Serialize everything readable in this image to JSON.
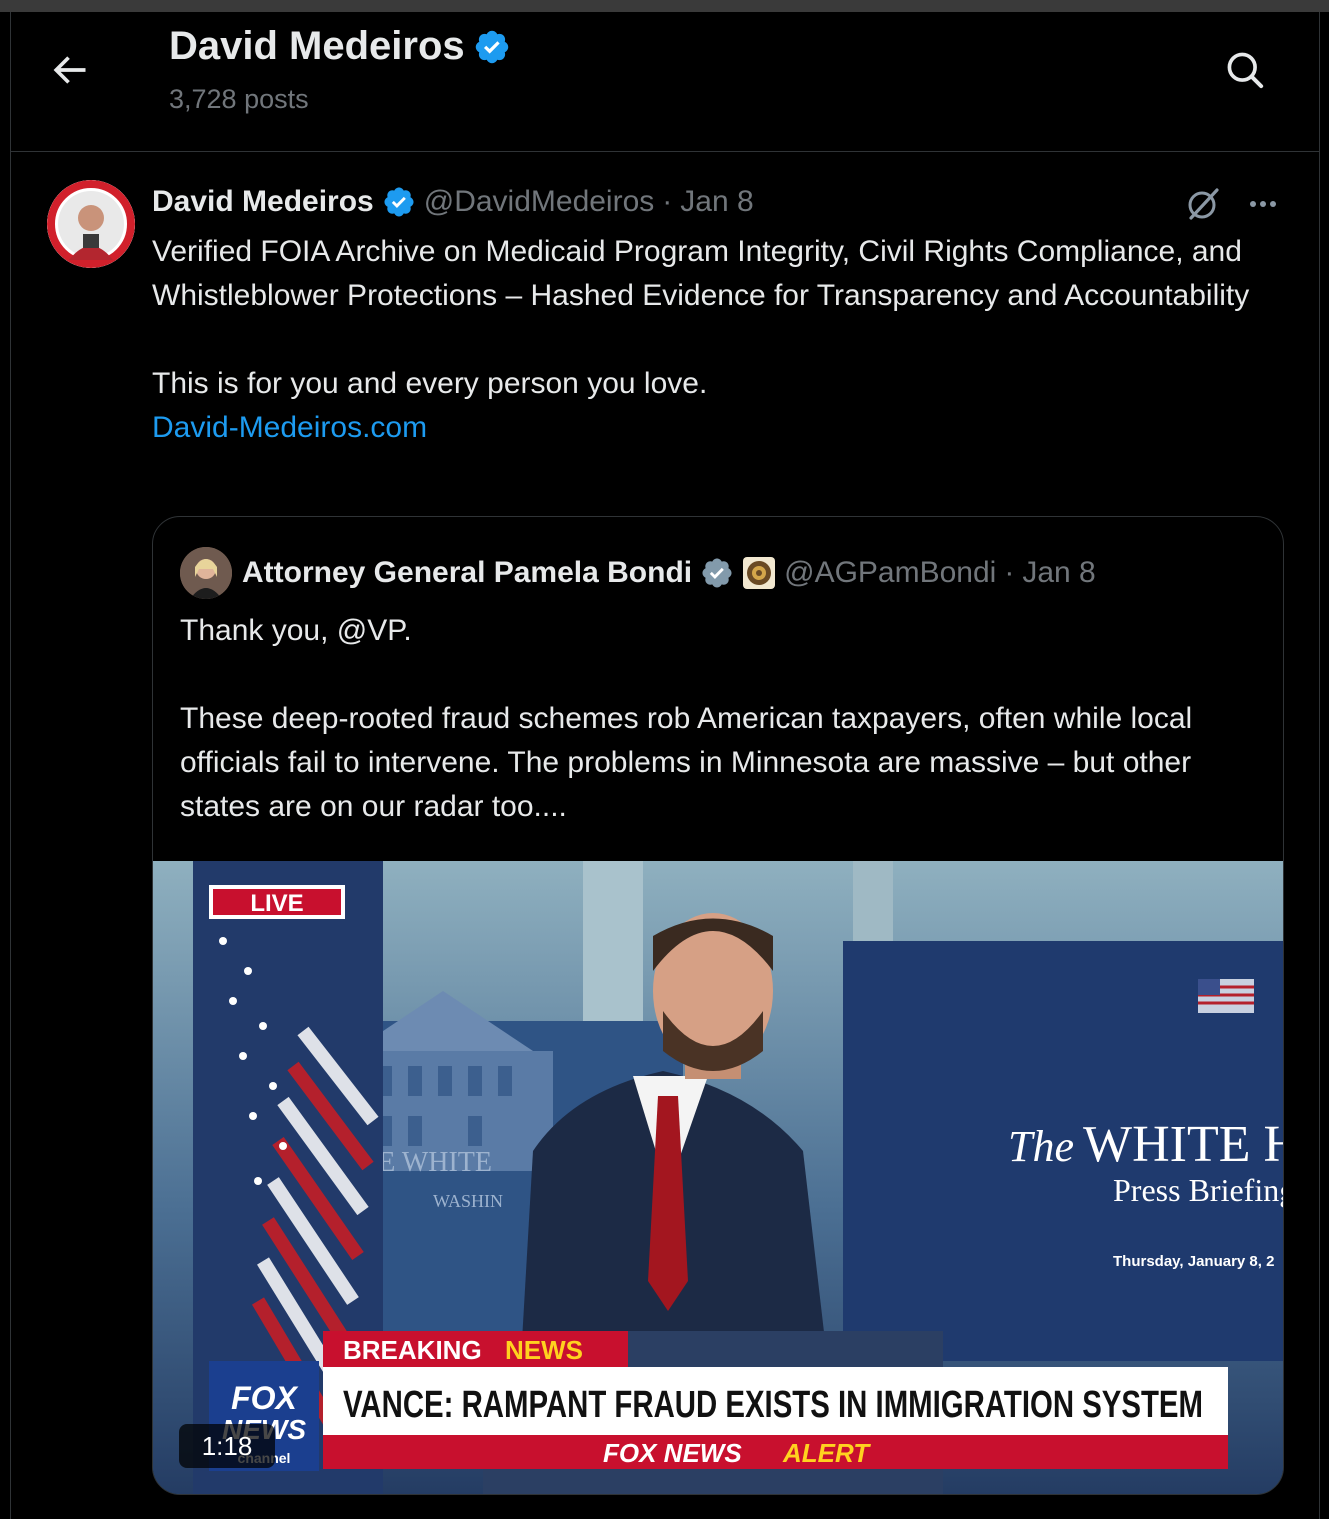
{
  "header": {
    "title": "David Medeiros",
    "post_count": "3,728 posts"
  },
  "post": {
    "author_name": "David Medeiros",
    "author_handle": "@DavidMedeiros",
    "separator": "·",
    "date": "Jan 8",
    "text_lines": [
      "Verified FOIA Archive on Medicaid Program Integrity, Civil Rights Compliance, and Whistleblower Protections – Hashed Evidence for Transparency and Accountability",
      "This is for you and every person you love."
    ],
    "link": "David-Medeiros.com"
  },
  "quote": {
    "author_name": "Attorney General Pamela Bondi",
    "author_handle": "@AGPamBondi",
    "separator": "·",
    "date": "Jan 8",
    "text_lines": [
      "Thank you, @VP.",
      "These deep-rooted fraud schemes rob American taxpayers, often while local officials fail to intervene. The problems in Minnesota are massive – but other states are on our radar too...."
    ]
  },
  "video": {
    "live_label": "LIVE",
    "backdrop_lines": [
      "HE WHITE",
      "WASHIN"
    ],
    "panel_the": "The",
    "panel_title": "WHITE HO",
    "panel_subtitle": "Press Briefing",
    "panel_date": "Thursday, January 8, 2",
    "breaking_a": "BREAKING",
    "breaking_b": "NEWS",
    "headline": "VANCE: RAMPANT FRAUD EXISTS IN IMMIGRATION SYSTEM",
    "alert_a": "FOX NEWS",
    "alert_b": "ALERT",
    "network_top": "FOX",
    "network_mid": "NEWS",
    "network_bottom": "channel",
    "duration": "1:18"
  },
  "colors": {
    "background": "#000000",
    "text": "#e7e9ea",
    "muted": "#71767b",
    "link": "#1d9bf0",
    "verified": "#1d9bf0",
    "fox_red": "#c8102e"
  }
}
